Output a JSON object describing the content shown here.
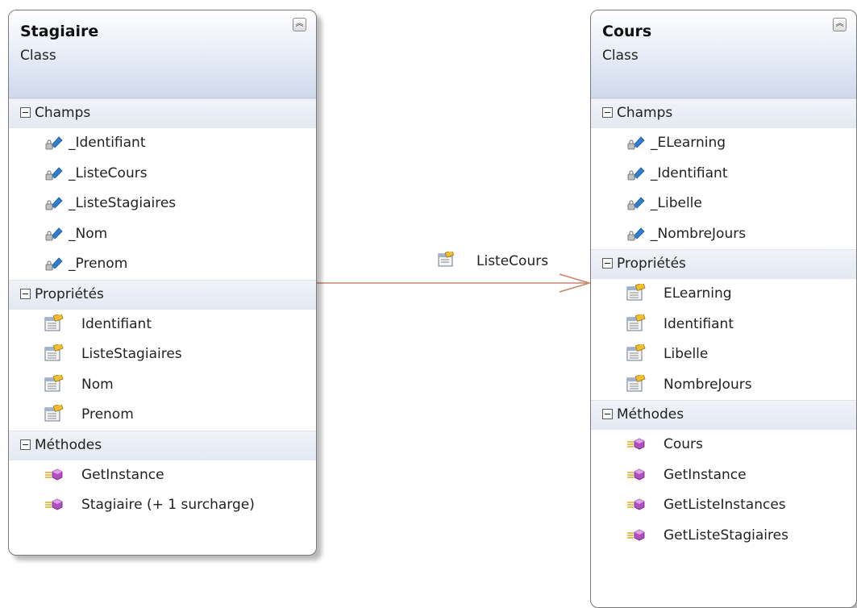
{
  "classes": [
    {
      "name": "Stagiaire",
      "stereotype": "Class",
      "fields_title": "Champs",
      "fields": [
        "_Identifiant",
        "_ListeCours",
        "_ListeStagiaires",
        "_Nom",
        "_Prenom"
      ],
      "properties_title": "Propriétés",
      "properties": [
        "Identifiant",
        "ListeStagiaires",
        "Nom",
        "Prenom"
      ],
      "methods_title": "Méthodes",
      "methods": [
        "GetInstance",
        "Stagiaire (+ 1 surcharge)"
      ]
    },
    {
      "name": "Cours",
      "stereotype": "Class",
      "fields_title": "Champs",
      "fields": [
        "_ELearning",
        "_Identifiant",
        "_Libelle",
        "_NombreJours"
      ],
      "properties_title": "Propriétés",
      "properties": [
        "ELearning",
        "Identifiant",
        "Libelle",
        "NombreJours"
      ],
      "methods_title": "Méthodes",
      "methods": [
        "Cours",
        "GetInstance",
        "GetListeInstances",
        "GetListeStagiaires"
      ]
    }
  ],
  "association": {
    "label": "ListeCours",
    "from": "Stagiaire",
    "to": "Cours",
    "line_color": "#c8866a"
  },
  "icons": {
    "field": "private-field-icon",
    "property": "property-icon",
    "method": "method-icon",
    "collapse": "collapse-chevrons-icon",
    "section_toggle": "minus-expander-icon"
  },
  "colors": {
    "header_gradient_bottom": "#cfd9ec",
    "section_bg": "#e8ecf4",
    "border": "#7a7a7a"
  }
}
